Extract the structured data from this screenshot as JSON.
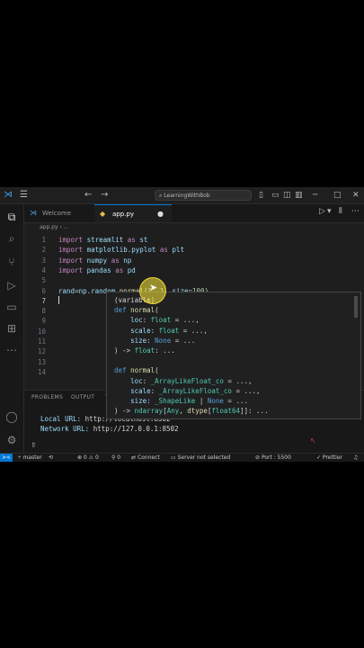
{
  "title_bar": {
    "search_text": "LearningWithBob",
    "back_arrow": "←",
    "forward_arrow": "→",
    "menu_icon": "☰",
    "layout_icons": [
      "▯",
      "▭",
      "◫",
      "▥"
    ],
    "minimize": "─",
    "maximize": "□",
    "close": "✕"
  },
  "tabs": [
    {
      "label": "Welcome",
      "icon": "vscode-icon"
    },
    {
      "label": "app.py",
      "icon": "python-icon",
      "modified": "●"
    }
  ],
  "editor_actions": [
    "▷",
    "▾",
    "⫴",
    "⋯"
  ],
  "breadcrumb": "app.py › ...",
  "code_lines": [
    {
      "num": "1",
      "parts": [
        [
          "kw",
          "import "
        ],
        [
          "id",
          "streamlit"
        ],
        [
          "kw",
          " as "
        ],
        [
          "id",
          "st"
        ]
      ]
    },
    {
      "num": "2",
      "parts": [
        [
          "kw",
          "import "
        ],
        [
          "id",
          "matplotlib.pyplot"
        ],
        [
          "kw",
          " as "
        ],
        [
          "id",
          "plt"
        ]
      ]
    },
    {
      "num": "3",
      "parts": [
        [
          "kw",
          "import "
        ],
        [
          "id",
          "numpy"
        ],
        [
          "kw",
          " as "
        ],
        [
          "id",
          "np"
        ]
      ]
    },
    {
      "num": "4",
      "parts": [
        [
          "kw",
          "import "
        ],
        [
          "id",
          "pandas"
        ],
        [
          "kw",
          " as "
        ],
        [
          "id",
          "pd"
        ]
      ]
    },
    {
      "num": "5",
      "parts": []
    },
    {
      "num": "6",
      "parts": [
        [
          "id",
          "rand"
        ],
        [
          "pl",
          "="
        ],
        [
          "id",
          "np"
        ],
        [
          "pl",
          "."
        ],
        [
          "id",
          "random"
        ],
        [
          "pl",
          "."
        ],
        [
          "fn",
          "normal"
        ],
        [
          "pl",
          "("
        ],
        [
          "num",
          "1"
        ],
        [
          "pl",
          ", "
        ],
        [
          "num",
          "1"
        ],
        [
          "pl",
          ", "
        ],
        [
          "id",
          "size"
        ],
        [
          "pl",
          "="
        ],
        [
          "num",
          "100"
        ],
        [
          "pl",
          ")"
        ]
      ]
    },
    {
      "num": "7",
      "parts": []
    },
    {
      "num": "8",
      "parts": []
    },
    {
      "num": "9",
      "parts": []
    },
    {
      "num": "10",
      "parts": []
    },
    {
      "num": "11",
      "parts": []
    },
    {
      "num": "12",
      "parts": []
    },
    {
      "num": "13",
      "parts": []
    },
    {
      "num": "14",
      "parts": []
    }
  ],
  "hover_lines": [
    [
      [
        "pl",
        "(variable)"
      ]
    ],
    [
      [
        "kw2",
        "def "
      ],
      [
        "fn",
        "normal"
      ],
      [
        "pl",
        "("
      ]
    ],
    [
      [
        "pl",
        "    "
      ],
      [
        "id",
        "loc"
      ],
      [
        "pl",
        ": "
      ],
      [
        "ty",
        "float"
      ],
      [
        "pl",
        " = ...,"
      ]
    ],
    [
      [
        "pl",
        "    "
      ],
      [
        "id",
        "scale"
      ],
      [
        "pl",
        ": "
      ],
      [
        "ty",
        "float"
      ],
      [
        "pl",
        " = ...,"
      ]
    ],
    [
      [
        "pl",
        "    "
      ],
      [
        "id",
        "size"
      ],
      [
        "pl",
        ": "
      ],
      [
        "kw2",
        "None"
      ],
      [
        "pl",
        " = ..."
      ]
    ],
    [
      [
        "pl",
        ") -> "
      ],
      [
        "ty",
        "float"
      ],
      [
        "pl",
        ": ..."
      ]
    ],
    [],
    [
      [
        "kw2",
        "def "
      ],
      [
        "fn",
        "normal"
      ],
      [
        "pl",
        "("
      ]
    ],
    [
      [
        "pl",
        "    "
      ],
      [
        "id",
        "loc"
      ],
      [
        "pl",
        ": "
      ],
      [
        "ty",
        "_ArrayLikeFloat_co"
      ],
      [
        "pl",
        " = ...,"
      ]
    ],
    [
      [
        "pl",
        "    "
      ],
      [
        "id",
        "scale"
      ],
      [
        "pl",
        ": "
      ],
      [
        "ty",
        "_ArrayLikeFloat_co"
      ],
      [
        "pl",
        " = ...,"
      ]
    ],
    [
      [
        "pl",
        "    "
      ],
      [
        "id",
        "size"
      ],
      [
        "pl",
        ": "
      ],
      [
        "ty",
        "_ShapeLike"
      ],
      [
        "pl",
        " | "
      ],
      [
        "kw2",
        "None"
      ],
      [
        "pl",
        " = ..."
      ]
    ],
    [
      [
        "pl",
        ") -> "
      ],
      [
        "ty",
        "ndarray"
      ],
      [
        "pl",
        "["
      ],
      [
        "ty",
        "Any"
      ],
      [
        "pl",
        ", "
      ],
      [
        "fn",
        "dtype"
      ],
      [
        "pl",
        "["
      ],
      [
        "ty",
        "float64"
      ],
      [
        "pl",
        "]]: ..."
      ]
    ]
  ],
  "panel": {
    "tabs": [
      "PROBLEMS",
      "OUTPUT",
      "T"
    ],
    "local_label": "Local URL: ",
    "local_url": "http://localhost:8502",
    "network_label": "Network URL: ",
    "network_url": "http://127.0.0.1:8502",
    "prompt": "▯"
  },
  "status_bar": {
    "remote": "><",
    "branch": "master",
    "sync": "⟲",
    "errors": "⊗ 0 ⚠ 0",
    "ports": "⚲ 0",
    "connect": "Connect",
    "server": "Server not selected",
    "port": "Port : 5500",
    "prettier": "✓ Prettier",
    "bell": "♫"
  }
}
